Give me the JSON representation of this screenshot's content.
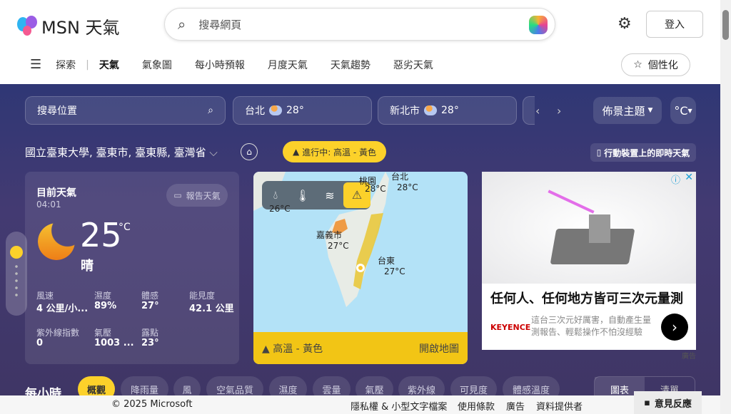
{
  "header": {
    "logo": "MSN 天氣",
    "search_placeholder": "搜尋網頁",
    "login": "登入",
    "personalize": "個性化"
  },
  "nav": {
    "items": [
      "探索",
      "天氣",
      "氣象圖",
      "每小時預報",
      "月度天氣",
      "天氣趨勢",
      "惡劣天氣"
    ],
    "active": "天氣"
  },
  "toolbar": {
    "location_search": "搜尋位置",
    "cities": [
      {
        "name": "台北",
        "temp": "28°"
      },
      {
        "name": "新北市",
        "temp": "28°"
      }
    ],
    "theme": "佈景主題",
    "unit": "°C"
  },
  "location": {
    "name": "國立臺東大學, 臺東市, 臺東縣, 臺灣省",
    "alert": "進行中: 高溫 - 黃色",
    "mobile": "行動裝置上的即時天氣"
  },
  "current": {
    "title": "目前天氣",
    "time": "04:01",
    "report": "報告天氣",
    "temp": "25",
    "unit": "°C",
    "condition": "晴",
    "details": [
      {
        "label": "風速",
        "value": "4 公里/小..."
      },
      {
        "label": "濕度",
        "value": "89%"
      },
      {
        "label": "體感",
        "value": "27°"
      },
      {
        "label": "能見度",
        "value": "42.1 公里"
      },
      {
        "label": "紫外線指數",
        "value": "0"
      },
      {
        "label": "氣壓",
        "value": "1003 ..."
      },
      {
        "label": "露點",
        "value": "23°"
      }
    ]
  },
  "map": {
    "labels": [
      {
        "name": "桃園",
        "temp": "28°C"
      },
      {
        "name": "台北",
        "temp": "28°C"
      },
      {
        "name": "",
        "temp": "26°C"
      },
      {
        "name": "嘉義市",
        "temp": "27°C"
      },
      {
        "name": "台東",
        "temp": "27°C"
      }
    ],
    "alert": "高溫 - 黃色",
    "open": "開啟地圖",
    "colors": {
      "alert": "#f2c515",
      "sea": "#b3e2f7"
    }
  },
  "ad": {
    "headline": "任何人、任何地方皆可三次元量測",
    "brand": "KEYENCE",
    "body": "這台三次元好厲害，自動產生量測報告、輕鬆操作不怕沒經驗",
    "label": "廣告"
  },
  "hourly": {
    "title": "每小時",
    "tabs": [
      "概觀",
      "降雨量",
      "風",
      "空氣品質",
      "濕度",
      "雲量",
      "氣壓",
      "紫外線",
      "可見度",
      "體感溫度"
    ],
    "view": [
      "圖表",
      "清單"
    ]
  },
  "footer": {
    "copyright": "© 2025 Microsoft",
    "links": [
      "隱私權 & 小型文字檔案",
      "使用條款",
      "廣告",
      "資料提供者"
    ],
    "feedback": "意見反應"
  }
}
